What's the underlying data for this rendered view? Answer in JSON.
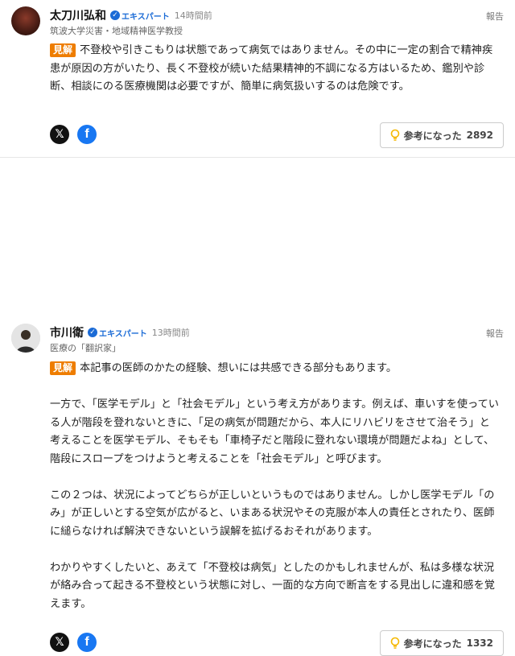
{
  "comments": [
    {
      "author": "太刀川弘和",
      "badge": "エキスパート",
      "time": "14時間前",
      "subtitle": "筑波大学災害・地域精神医学教授",
      "report": "報告",
      "tag": "見解",
      "paragraphs": [
        "不登校や引きこもりは状態であって病気ではありません。その中に一定の割合で精神疾患が原因の方がいたり、長く不登校が続いた結果精神的不調になる方はいるため、鑑別や診断、相談にのる医療機関は必要ですが、簡単に病気扱いするのは危険です。"
      ],
      "helpful_label": "参考になった",
      "helpful_count": "2892"
    },
    {
      "author": "市川衛",
      "badge": "エキスパート",
      "time": "13時間前",
      "subtitle": "医療の「翻訳家」",
      "report": "報告",
      "tag": "見解",
      "paragraphs": [
        "本記事の医師のかたの経験、想いには共感できる部分もあります。",
        "一方で、「医学モデル」と「社会モデル」という考え方があります。例えば、車いすを使っている人が階段を登れないときに、「足の病気が問題だから、本人にリハビリをさせて治そう」と考えることを医学モデル、そもそも「車椅子だと階段に登れない環境が問題だよね」として、階段にスロープをつけようと考えることを「社会モデル」と呼びます。",
        "この２つは、状況によってどちらが正しいというものではありません。しかし医学モデル「のみ」が正しいとする空気が広がると、いまある状況やその克服が本人の責任とされたり、医師に縋らなければ解決できないという誤解を拡げるおそれがあります。",
        "わかりやすくしたいと、あえて「不登校は病気」としたのかもしれませんが、私は多様な状況が絡み合って起きる不登校という状態に対し、一面的な方向で断言をする見出しに違和感を覚えます。"
      ],
      "helpful_label": "参考になった",
      "helpful_count": "1332"
    }
  ],
  "icons": {
    "badge": "check-badge-icon",
    "share_x": "x-logo-icon",
    "share_fb": "facebook-logo-icon",
    "helpful": "lightbulb-icon"
  },
  "colors": {
    "tag": "#ee7d00",
    "badge": "#1b6bd6",
    "facebook": "#1877f2",
    "bulb": "#f5b800"
  }
}
